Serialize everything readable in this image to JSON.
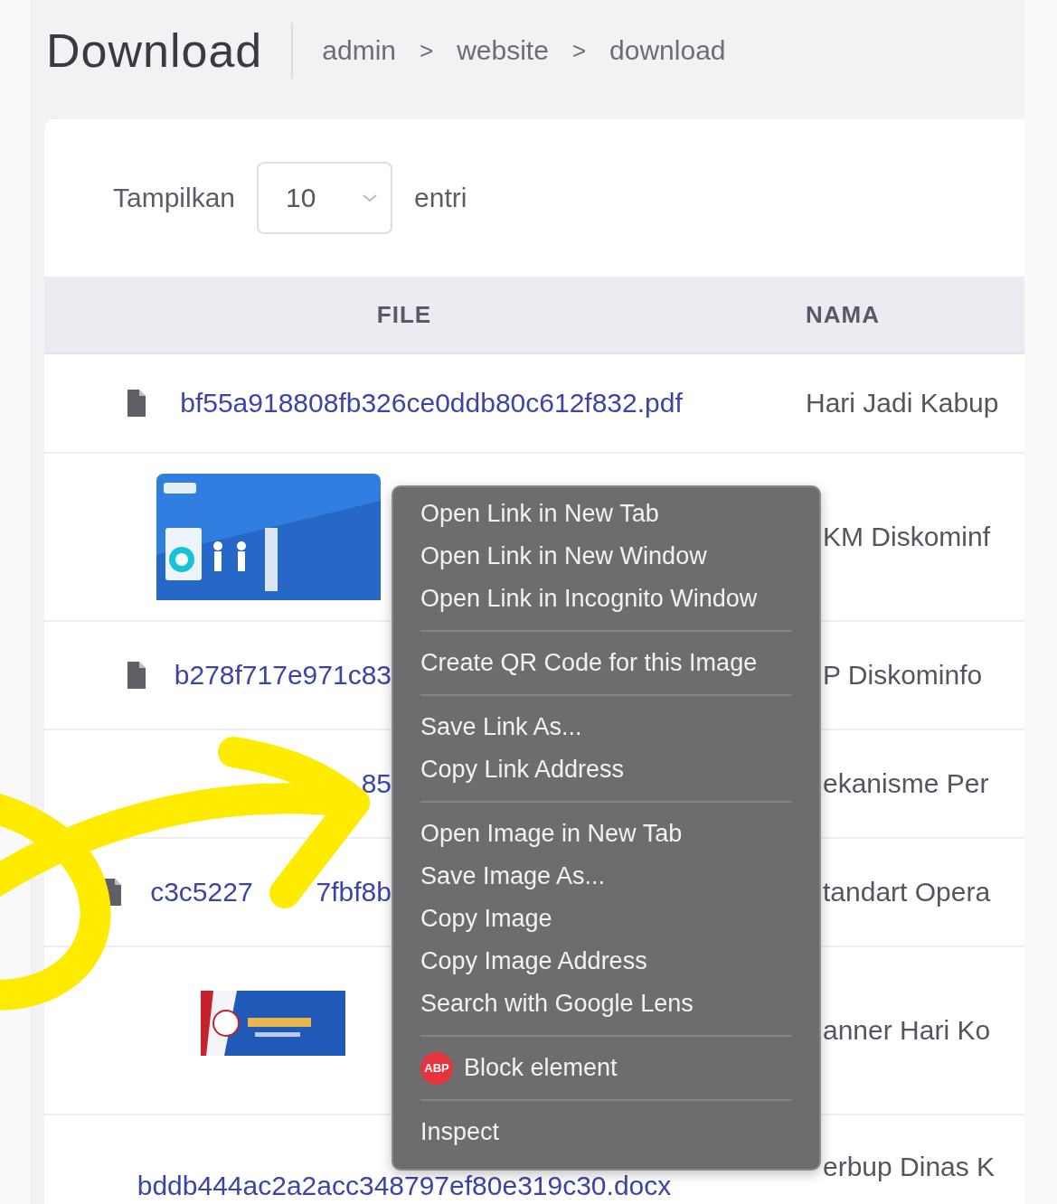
{
  "page": {
    "title": "Download",
    "breadcrumb": [
      "admin",
      "website",
      "download"
    ],
    "separator": ">"
  },
  "length_control": {
    "label": "Tampilkan",
    "value": "10",
    "suffix": "entri"
  },
  "table": {
    "columns": [
      "FILE",
      "NAMA"
    ],
    "rows": [
      {
        "kind": "file",
        "icon": true,
        "file": "bf55a918808fb326ce0ddb80c612f832.pdf",
        "name": "Hari Jadi Kabup",
        "behind_menu": false
      },
      {
        "kind": "picture",
        "name": "KM Diskominf",
        "behind_menu": true
      },
      {
        "kind": "covered-file",
        "icon": true,
        "file_parts": [
          "b278f717e971c83"
        ],
        "name": "P Diskominfo",
        "behind_menu": true
      },
      {
        "kind": "covered-file",
        "icon": false,
        "file_parts": [
          "85"
        ],
        "name": "ekanisme Per",
        "behind_menu": true
      },
      {
        "kind": "covered-file",
        "icon": true,
        "file_parts": [
          "c3c5227",
          "7fbf8b"
        ],
        "name": "tandart Opera",
        "behind_menu": true
      },
      {
        "kind": "picture",
        "name": "anner Hari Ko",
        "behind_menu": true
      },
      {
        "kind": "file",
        "icon": false,
        "file": "bddb444ac2a2acc348797ef80e319c30.docx",
        "name": "erbup Dinas K",
        "behind_menu": true
      }
    ]
  },
  "context_menu": {
    "groups": [
      [
        {
          "label": "Open Link in New Tab"
        },
        {
          "label": "Open Link in New Window"
        },
        {
          "label": "Open Link in Incognito Window"
        }
      ],
      [
        {
          "label": "Create QR Code for this Image"
        }
      ],
      [
        {
          "label": "Save Link As..."
        },
        {
          "label": "Copy Link Address"
        }
      ],
      [
        {
          "label": "Open Image in New Tab"
        },
        {
          "label": "Save Image As..."
        },
        {
          "label": "Copy Image"
        },
        {
          "label": "Copy Image Address"
        },
        {
          "label": "Search with Google Lens"
        }
      ],
      [
        {
          "label": "Block element",
          "badge": "ABP"
        }
      ],
      [
        {
          "label": "Inspect"
        }
      ]
    ]
  },
  "annotation": {
    "kind": "arrow"
  }
}
